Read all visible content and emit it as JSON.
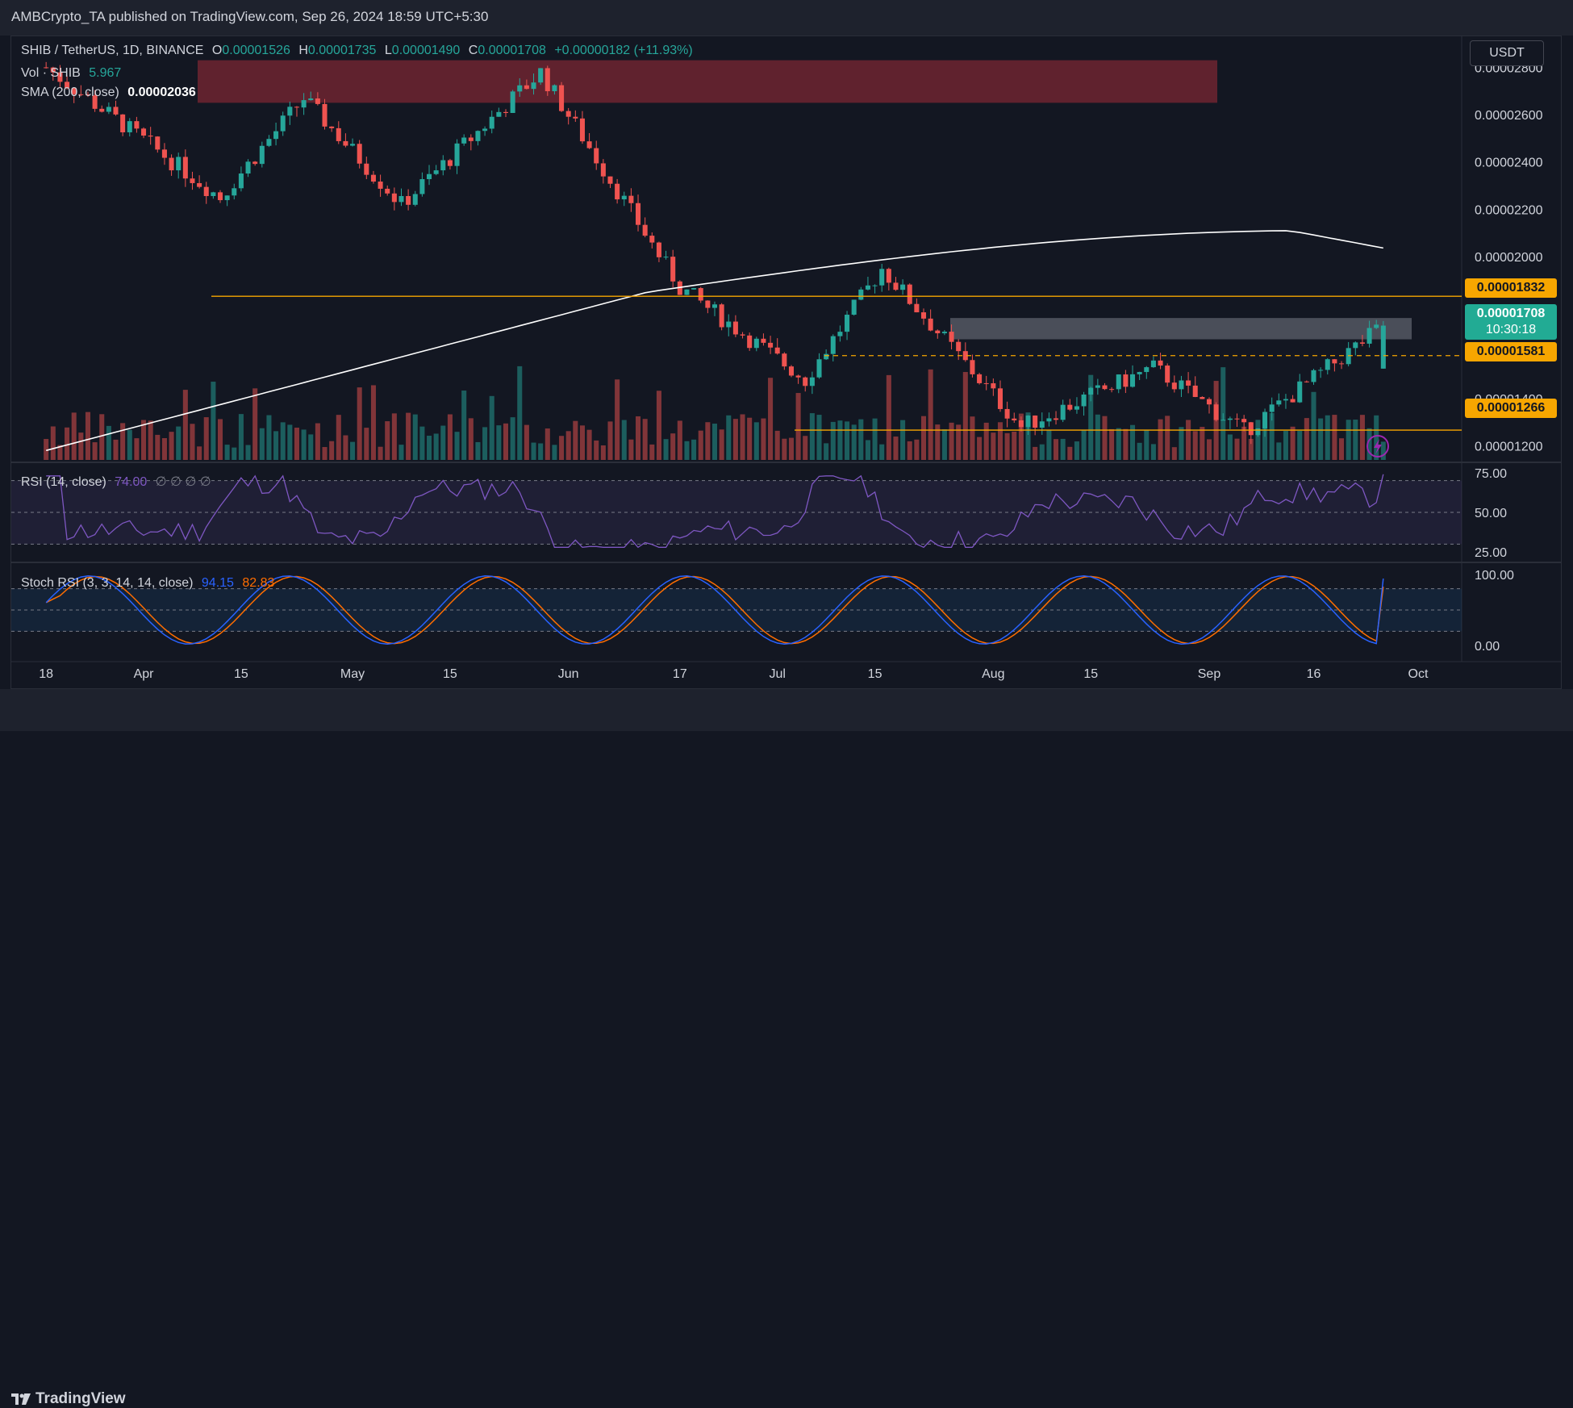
{
  "header": {
    "publisher_line": "AMBCrypto_TA published on TradingView.com, Sep 26, 2024 18:59 UTC+5:30"
  },
  "footer": {
    "brand": "TradingView"
  },
  "currency_button": "USDT",
  "legend": {
    "symbol": "SHIB / TetherUS, 1D, BINANCE",
    "o_label": "O",
    "o_value": "0.00001526",
    "h_label": "H",
    "h_value": "0.00001735",
    "l_label": "L",
    "l_value": "0.00001490",
    "c_label": "C",
    "c_value": "0.00001708",
    "change": "+0.00000182 (+11.93%)",
    "vol_label": "Vol · SHIB",
    "vol_value": "5.967",
    "sma_label": "SMA (200, close)",
    "sma_value": "0.00002036",
    "rsi_label": "RSI (14, close)",
    "rsi_value": "74.00",
    "rsi_extra": "∅ ∅ ∅ ∅",
    "stoch_label": "Stoch RSI (3, 3, 14, 14, close)",
    "stoch_k": "94.15",
    "stoch_d": "82.83"
  },
  "price_labels": {
    "current": "0.00001708",
    "countdown": "10:30:18",
    "resistance": "0.00001832",
    "level_mid": "0.00001581",
    "support": "0.00001266"
  },
  "colors": {
    "up": "#26a69a",
    "down": "#ef5350",
    "sma": "#ffffff",
    "level": "#f7a600",
    "rsi_line": "#7e57c2",
    "stoch_k": "#2962ff",
    "stoch_d": "#ff6d00",
    "resistance_zone": "#f23645",
    "grey_zone": "#787b86"
  },
  "chart_data": [
    {
      "type": "candlestick",
      "title": "SHIB / TetherUS, 1D, BINANCE",
      "x_ticks": [
        "18",
        "Apr",
        "15",
        "May",
        "15",
        "Jun",
        "17",
        "Jul",
        "15",
        "Aug",
        "15",
        "Sep",
        "16",
        "Oct"
      ],
      "y_ticks": [
        "0.00002800",
        "0.00002600",
        "0.00002400",
        "0.00002200",
        "0.00002000",
        "0.00001400",
        "0.00001200"
      ],
      "ylim": [
        1.14e-05,
        2.88e-05
      ],
      "zones": [
        {
          "name": "resistance zone",
          "from": 2.65e-05,
          "to": 2.83e-05
        },
        {
          "name": "supply zone",
          "from": 1.65e-05,
          "to": 1.74e-05
        }
      ],
      "levels": [
        1.832e-05,
        1.581e-05,
        1.266e-05
      ],
      "key_points": [
        {
          "x": "Mar 18",
          "close": 2.8e-05
        },
        {
          "x": "Apr 12",
          "close": 2.25e-05
        },
        {
          "x": "Apr 24",
          "close": 2.67e-05
        },
        {
          "x": "May 8",
          "close": 2.22e-05
        },
        {
          "x": "May 28",
          "close": 2.78e-05
        },
        {
          "x": "Jun 17",
          "close": 1.87e-05
        },
        {
          "x": "Jul 5",
          "close": 1.48e-05
        },
        {
          "x": "Jul 16",
          "close": 1.95e-05
        },
        {
          "x": "Aug 5",
          "close": 1.28e-05
        },
        {
          "x": "Aug 24",
          "close": 1.53e-05
        },
        {
          "x": "Sep 6",
          "close": 1.26e-05
        },
        {
          "x": "Sep 26",
          "close": 1.708e-05
        }
      ],
      "sma_200_end": 2.036e-05
    },
    {
      "type": "line",
      "title": "RSI (14, close)",
      "y_ticks": [
        "75.00",
        "50.00",
        "25.00"
      ],
      "ylim": [
        20,
        80
      ],
      "last": 74.0
    },
    {
      "type": "line",
      "title": "Stoch RSI (3, 3, 14, 14, close)",
      "y_ticks": [
        "100.00",
        "0.00"
      ],
      "ylim": [
        0,
        100
      ],
      "series": [
        {
          "name": "K",
          "last": 94.15
        },
        {
          "name": "D",
          "last": 82.83
        }
      ]
    }
  ]
}
